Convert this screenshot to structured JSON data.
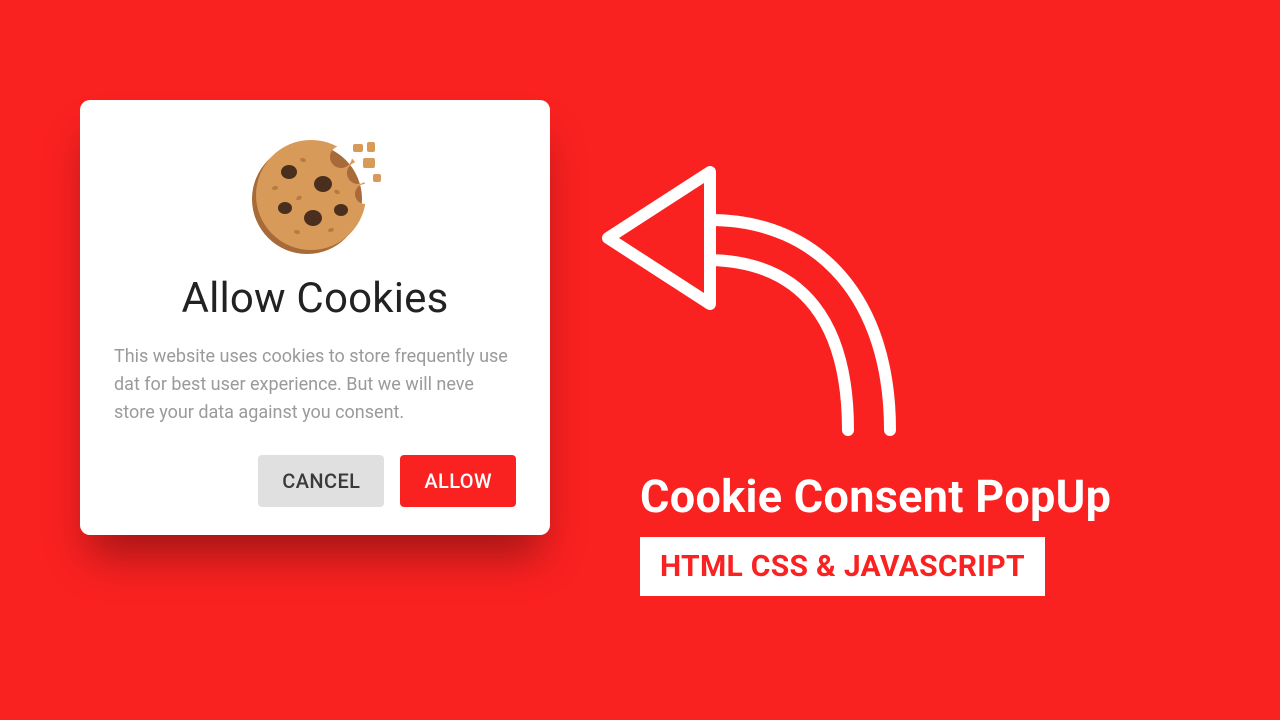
{
  "colors": {
    "background": "#fa2121",
    "card_bg": "#ffffff",
    "text_muted": "#9a9a9a",
    "btn_cancel_bg": "#e0e0e0",
    "btn_allow_bg": "#fa2121"
  },
  "popup": {
    "icon_name": "cookie-icon",
    "title": "Allow Cookies",
    "body": "This website uses cookies to store frequently use dat for best user experience. But we will neve store your data against you consent.",
    "cancel_label": "CANCEL",
    "allow_label": "ALLOW"
  },
  "promo": {
    "arrow_icon_name": "curved-arrow-left-icon",
    "heading": "Cookie Consent PopUp",
    "tag": "HTML CSS & JAVASCRIPT"
  }
}
